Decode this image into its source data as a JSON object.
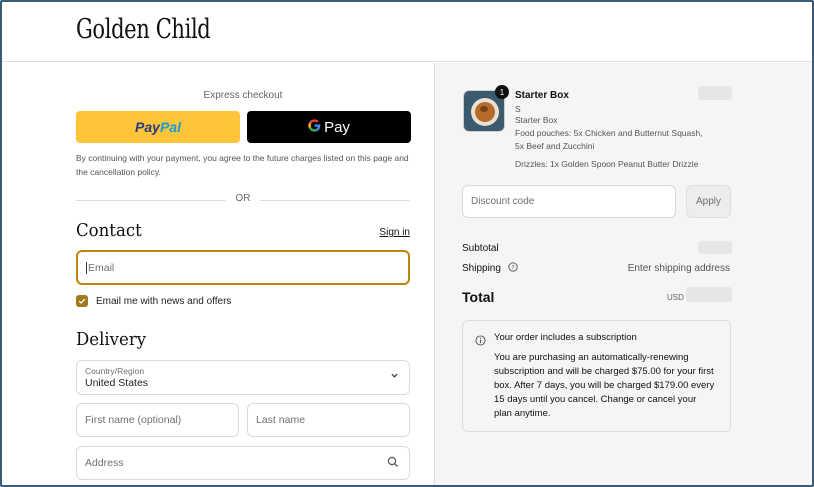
{
  "header": {
    "logo_text": "Golden Child"
  },
  "express": {
    "label": "Express checkout",
    "paypal_part1": "Pay",
    "paypal_part2": "Pal",
    "gpay_label": "Pay",
    "disclaimer": "By continuing with your payment, you agree to the future charges listed on this page and the cancellation policy.",
    "or_text": "OR"
  },
  "contact": {
    "title": "Contact",
    "signin": "Sign in",
    "email_placeholder": "Email",
    "newsletter_label": "Email me with news and offers",
    "newsletter_checked": true
  },
  "delivery": {
    "title": "Delivery",
    "country_label": "Country/Region",
    "country_value": "United States",
    "first_name_placeholder": "First name (optional)",
    "last_name_placeholder": "Last name",
    "address_placeholder": "Address"
  },
  "order": {
    "item": {
      "quantity": "1",
      "title": "Starter Box",
      "variant": "S",
      "subtitle": "Starter Box",
      "details1": "Food pouches: 5x Chicken and Butternut Squash, 5x Beef and Zucchini",
      "details2": "Drizzles: 1x Golden Spoon Peanut Butter Drizzle"
    },
    "discount_placeholder": "Discount code",
    "apply_label": "Apply",
    "subtotal_label": "Subtotal",
    "shipping_label": "Shipping",
    "shipping_value": "Enter shipping address",
    "total_label": "Total",
    "currency": "USD",
    "notice_title": "Your order includes a subscription",
    "notice_body": "You are purchasing an automatically-renewing subscription and will be charged $75.00 for your first box. After 7 days, you will be charged $179.00 every 15 days until you cancel. Change or cancel your plan anytime."
  },
  "colors": {
    "paypal_bg": "#ffc439",
    "gpay_bg": "#000000",
    "accent": "#a07a1d",
    "focus_border": "#b8860b",
    "summary_bg": "#f5f5f5"
  }
}
